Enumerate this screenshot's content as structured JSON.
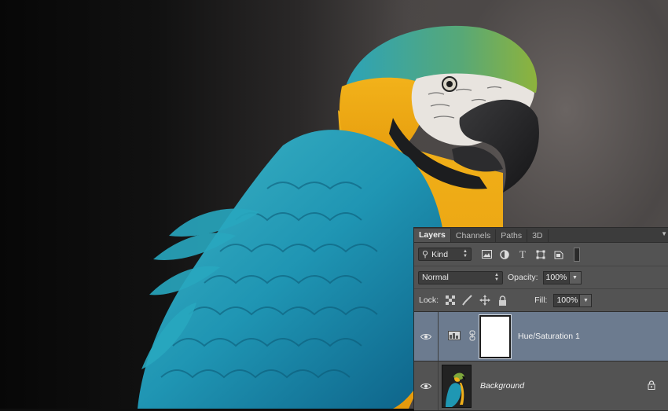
{
  "canvas": {
    "subject": "macaw-photo"
  },
  "layers_panel": {
    "tabs": [
      {
        "label": "Layers",
        "active": true
      },
      {
        "label": "Channels",
        "active": false
      },
      {
        "label": "Paths",
        "active": false
      },
      {
        "label": "3D",
        "active": false
      }
    ],
    "filter": {
      "kind_label": "Kind"
    },
    "blend_mode": "Normal",
    "opacity_label": "Opacity:",
    "opacity_value": "100%",
    "lock_label": "Lock:",
    "fill_label": "Fill:",
    "fill_value": "100%",
    "layers": [
      {
        "name": "Hue/Saturation 1",
        "type": "adjustment",
        "selected": true,
        "visible": true
      },
      {
        "name": "Background",
        "type": "background",
        "selected": false,
        "visible": true,
        "locked": true
      }
    ]
  }
}
